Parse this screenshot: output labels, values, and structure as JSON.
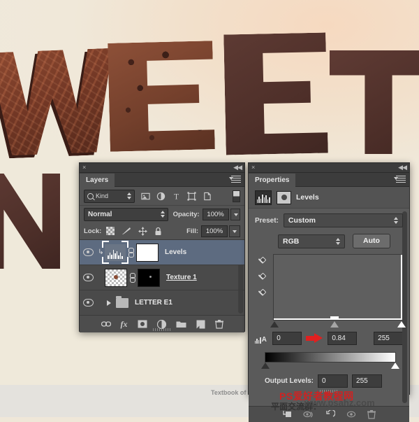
{
  "app": "Adobe Photoshop",
  "artwork": {
    "letters": [
      "W",
      "E",
      "E",
      "T",
      "N"
    ],
    "description": "chocolate 3D lettering"
  },
  "layers_panel": {
    "close_icon": "×",
    "collapse_icon": "◀◀",
    "tab_label": "Layers",
    "filter": {
      "search_icon": "search-icon",
      "kind_label": "Kind",
      "icons": [
        "pixel-layer-icon",
        "adjustment-layer-icon",
        "type-layer-icon",
        "shape-layer-icon",
        "smart-object-icon"
      ],
      "toggle": "filter-toggle"
    },
    "blend": {
      "mode": "Normal",
      "opacity_label": "Opacity:",
      "opacity_value": "100%"
    },
    "lock": {
      "label": "Lock:",
      "icons": [
        "lock-transparency-icon",
        "lock-image-icon",
        "lock-position-icon",
        "lock-all-icon"
      ],
      "fill_label": "Fill:",
      "fill_value": "100%"
    },
    "rows": [
      {
        "name": "Levels",
        "type": "adjustment",
        "selected": true,
        "clipped": true,
        "visible": true,
        "underline": false
      },
      {
        "name": "Texture 1",
        "type": "pixel",
        "selected": false,
        "clipped": false,
        "visible": true,
        "underline": true
      },
      {
        "name": "LETTER E1",
        "type": "group",
        "selected": false,
        "clipped": false,
        "visible": true,
        "underline": false
      }
    ],
    "footer_icons": [
      "link-layers-icon",
      "fx-icon",
      "add-mask-icon",
      "new-adjustment-icon",
      "new-group-icon",
      "new-layer-icon",
      "delete-layer-icon"
    ],
    "fx_label": "fx"
  },
  "properties_panel": {
    "close_icon": "×",
    "collapse_icon": "◀◀",
    "tab_label": "Properties",
    "header_title": "Levels",
    "header_icons": [
      "levels-icon",
      "layer-mask-icon"
    ],
    "preset_label": "Preset:",
    "preset_value": "Custom",
    "channel_value": "RGB",
    "auto_button": "Auto",
    "dropper_icons": [
      "black-point-dropper-icon",
      "gray-point-dropper-icon",
      "white-point-dropper-icon"
    ],
    "input_levels": {
      "black": "0",
      "gamma": "0.84",
      "white": "255"
    },
    "output_levels": {
      "label": "Output Levels:",
      "black": "0",
      "white": "255"
    },
    "footer_icons": [
      "clip-to-layer-icon",
      "view-previous-state-icon",
      "reset-icon",
      "toggle-visibility-icon",
      "delete-adjustment-icon"
    ]
  },
  "watermark": {
    "textbook": "Textbook of translation",
    "site_cn": "PS爱好者教程网",
    "group_cn": "平面交流群：",
    "url": "www.psahz.com"
  },
  "colors": {
    "panel_bg": "#535353",
    "panel_body": "#5a5a5a",
    "selected_row": "#5d6b80",
    "accent_red": "#e02020",
    "text": "#e8e8e8"
  }
}
